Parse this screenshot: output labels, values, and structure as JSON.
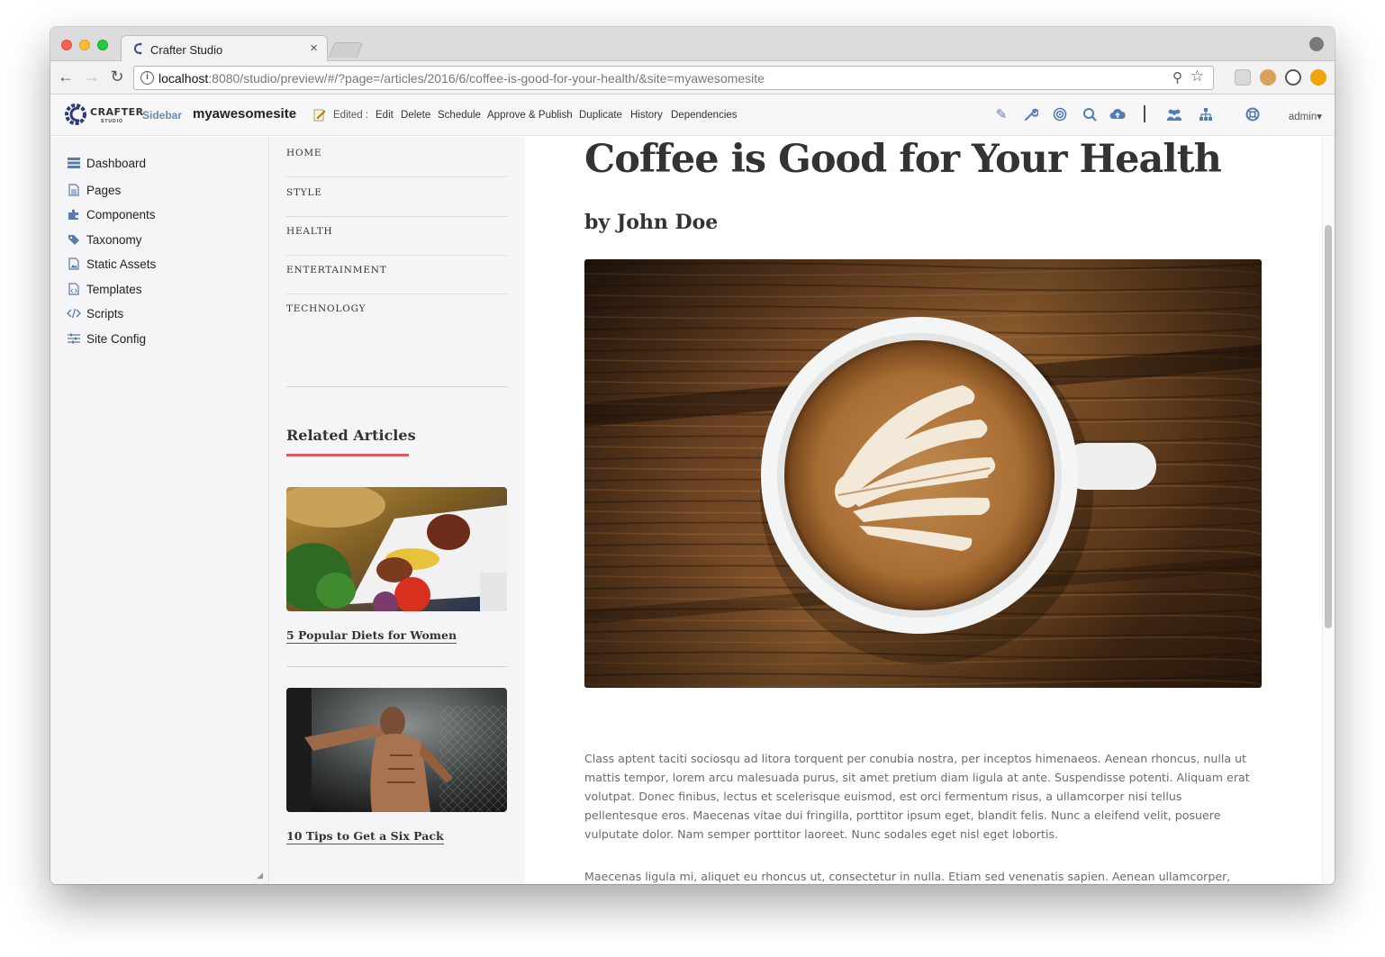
{
  "browser": {
    "tab_title": "Crafter Studio",
    "tab_close": "×",
    "url_host": "localhost",
    "url_rest": ":8080/studio/preview/#/?page=/articles/2016/6/coffee-is-good-for-your-health/&site=myawesomesite",
    "back": "←",
    "forward": "→",
    "reload": "↻",
    "zoom_icon": "⚲",
    "star_icon": "☆"
  },
  "toolbar": {
    "logo_text": "CRAFTER",
    "logo_sub": "STUDIO",
    "sidebar_label": "Sidebar",
    "site_name": "myawesomesite",
    "edited_label": "Edited :",
    "actions": [
      "Edit",
      "Delete",
      "Schedule",
      "Approve & Publish",
      "Duplicate",
      "History",
      "Dependencies"
    ],
    "admin_label": "admin",
    "admin_caret": "▾"
  },
  "studio_sidebar": {
    "items": [
      {
        "label": "Dashboard",
        "icon": "dashboard-icon"
      },
      {
        "label": "Pages",
        "icon": "pages-icon"
      },
      {
        "label": "Components",
        "icon": "puzzle-icon"
      },
      {
        "label": "Taxonomy",
        "icon": "tags-icon"
      },
      {
        "label": "Static Assets",
        "icon": "image-file-icon"
      },
      {
        "label": "Templates",
        "icon": "code-file-icon"
      },
      {
        "label": "Scripts",
        "icon": "code-icon"
      },
      {
        "label": "Site Config",
        "icon": "sliders-icon"
      }
    ],
    "grip": "◢"
  },
  "site_nav": {
    "items": [
      "HOME",
      "STYLE",
      "HEALTH",
      "ENTERTAINMENT",
      "TECHNOLOGY"
    ],
    "related_title": "Related Articles",
    "related": [
      {
        "title": "5 Popular Diets for Women"
      },
      {
        "title": "10 Tips to Get a Six Pack"
      }
    ]
  },
  "article": {
    "title": "Coffee is Good for Your Health",
    "byline": "by John Doe",
    "paragraphs": [
      "Class aptent taciti sociosqu ad litora torquent per conubia nostra, per inceptos himenaeos. Aenean rhoncus, nulla ut mattis tempor, lorem arcu malesuada purus, sit amet pretium diam ligula at ante. Suspendisse potenti. Aliquam erat volutpat. Donec finibus, lectus et scelerisque euismod, est orci fermentum risus, a ullamcorper nisi tellus pellentesque eros. Maecenas vitae dui fringilla, porttitor ipsum eget, blandit felis. Nunc a eleifend velit, posuere vulputate dolor. Nam semper porttitor laoreet. Nunc sodales eget nisl eget lobortis.",
      "Maecenas ligula mi, aliquet eu rhoncus ut, consectetur in nulla. Etiam sed venenatis sapien. Aenean ullamcorper, turpis vitae interdum malesuada, turpis leo interdum nisi, a placerat sem dui at justo. Aliquam a lobortis orci. Etiam eget"
    ]
  },
  "colors": {
    "accent_red": "#e05b5b",
    "studio_blue": "#4f7db8"
  }
}
